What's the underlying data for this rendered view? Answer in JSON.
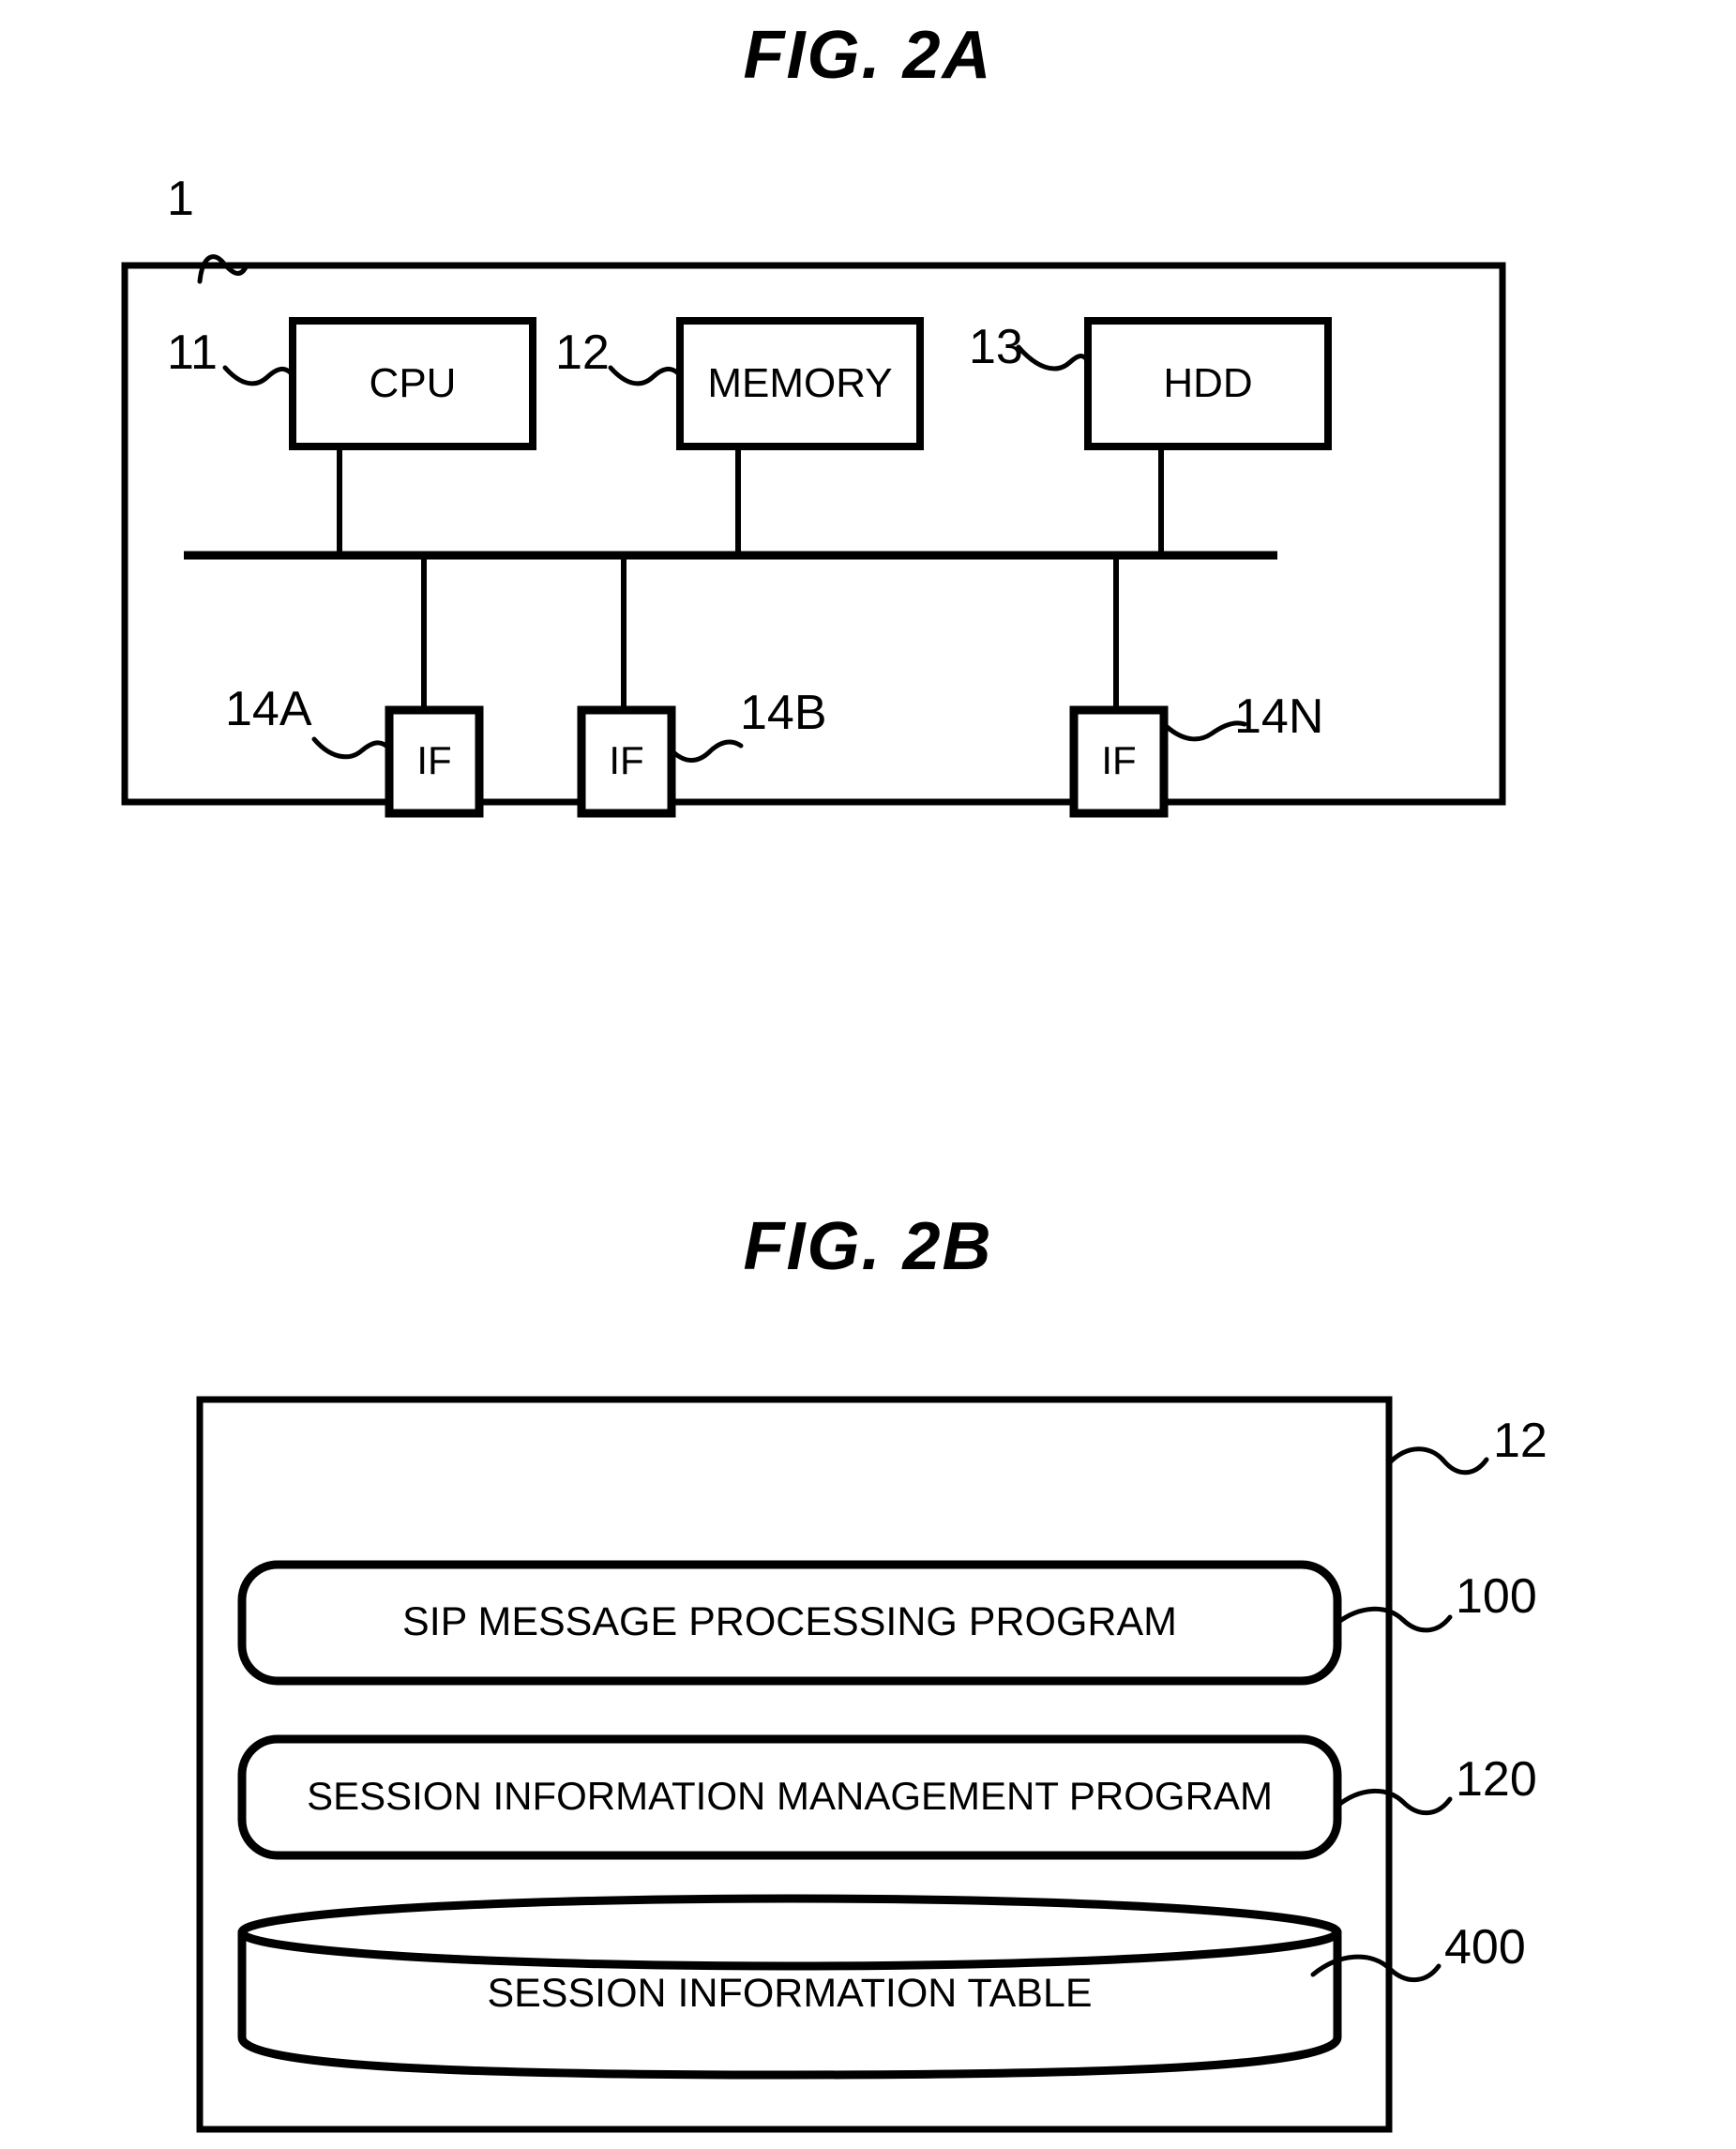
{
  "figures": [
    {
      "id": "fig-2a",
      "title": "FIG.  2A",
      "outer_ref": "1",
      "components": [
        {
          "name": "cpu",
          "label": "CPU",
          "ref": "11"
        },
        {
          "name": "memory",
          "label": "MEMORY",
          "ref": "12"
        },
        {
          "name": "hdd",
          "label": "HDD",
          "ref": "13"
        }
      ],
      "interfaces": [
        {
          "name": "if-a",
          "label": "IF",
          "ref": "14A"
        },
        {
          "name": "if-b",
          "label": "IF",
          "ref": "14B"
        },
        {
          "name": "if-n",
          "label": "IF",
          "ref": "14N"
        }
      ]
    },
    {
      "id": "fig-2b",
      "title": "FIG.  2B",
      "outer_ref": "12",
      "items": [
        {
          "name": "sip-message-processing-program",
          "label": "SIP MESSAGE PROCESSING PROGRAM",
          "ref": "100",
          "shape": "rounded-rect"
        },
        {
          "name": "session-information-management-program",
          "label": "SESSION INFORMATION MANAGEMENT PROGRAM",
          "ref": "120",
          "shape": "rounded-rect"
        },
        {
          "name": "session-information-table",
          "label": "SESSION INFORMATION TABLE",
          "ref": "400",
          "shape": "cylinder"
        }
      ]
    }
  ],
  "colors": {
    "ink": "#000000",
    "paper": "#ffffff"
  }
}
